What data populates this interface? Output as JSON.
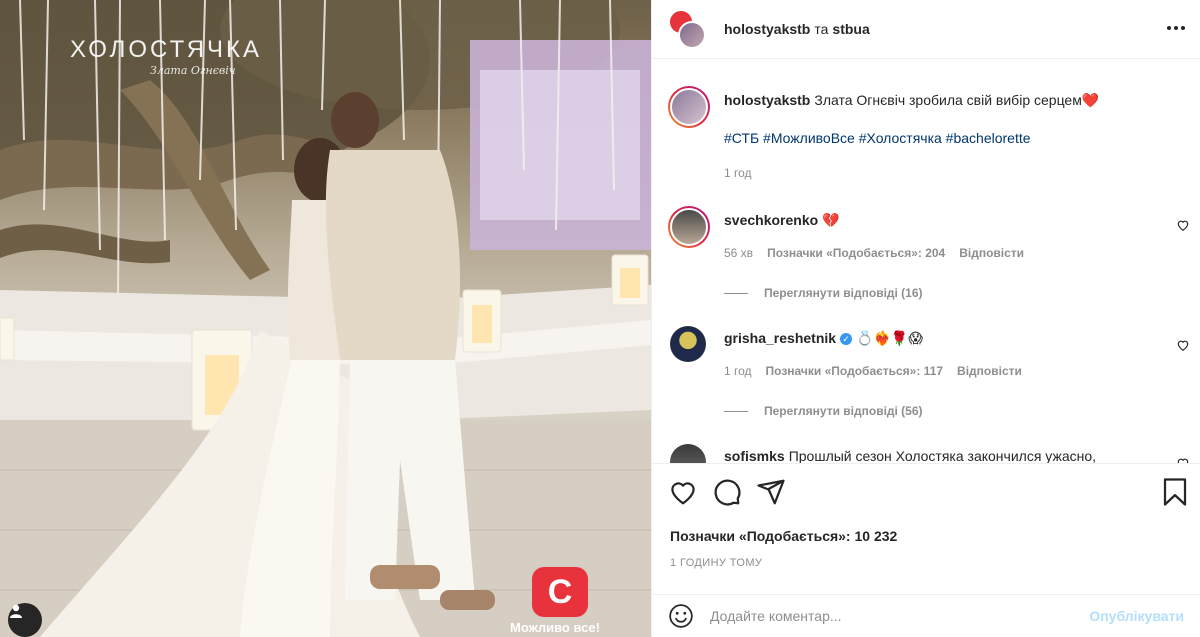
{
  "photo": {
    "watermark_title": "ХОЛОСТЯЧКА",
    "watermark_signature": "Злата Огнєвіч",
    "brand_logo_letter": "С",
    "brand_slogan": "Можливо все!",
    "brand_color": "#e8323c"
  },
  "header": {
    "author": "holostyakstb",
    "conjunction": "та",
    "coauthor": "stbua"
  },
  "caption": {
    "username": "holostyakstb",
    "text": "Злата Огнєвіч зробила свій вибір серцем❤️",
    "hashtags": "#СТБ #МожливоВсе #Холостячка #bachelorette",
    "time": "1 год"
  },
  "comments": [
    {
      "username": "svechkorenko",
      "text": "💔",
      "time": "56 хв",
      "likes": "Позначки «Подобається»: 204",
      "reply": "Відповісти",
      "view_replies": "Переглянути відповіді (16)"
    },
    {
      "username": "grisha_reshetnik",
      "verified": true,
      "text": "💍❤️‍🔥🌹😱",
      "time": "1 год",
      "likes": "Позначки «Подобається»: 117",
      "reply": "Відповісти",
      "view_replies": "Переглянути відповіді (56)"
    },
    {
      "username": "sofismks",
      "text": "Прошлый сезон Холостяка закончился ужасно,"
    }
  ],
  "likes_total": "Позначки «Подобається»: 10 232",
  "timestamp": "1 ГОДИНУ ТОМУ",
  "add_comment": {
    "placeholder": "Додайте коментар...",
    "post_label": "Опублікувати"
  },
  "icons": [
    "heart-icon",
    "comment-icon",
    "share-icon",
    "bookmark-icon",
    "emoji-icon",
    "more-icon"
  ],
  "colors": {
    "link": "#00376b",
    "muted": "#8e8e8e",
    "post_disabled": "#b2dffc",
    "verified": "#3897f0"
  }
}
